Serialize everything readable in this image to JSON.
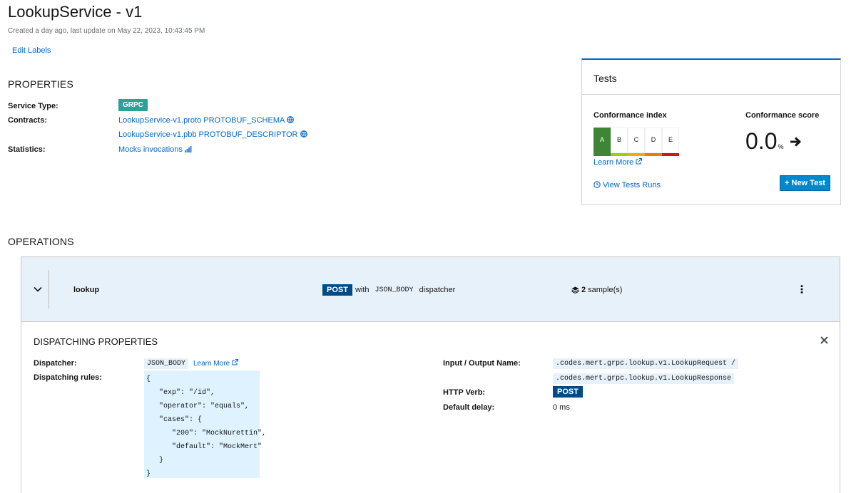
{
  "header": {
    "title": "LookupService - v1",
    "subtitle": "Created a day ago, last update on May 22, 2023, 10:43:45 PM",
    "edit_labels": "Edit Labels"
  },
  "properties": {
    "heading": "PROPERTIES",
    "service_type_label": "Service Type:",
    "service_type": "GRPC",
    "contracts_label": "Contracts:",
    "contracts": [
      "LookupService-v1.proto PROTOBUF_SCHEMA",
      "LookupService-v1.pbb PROTOBUF_DESCRIPTOR"
    ],
    "statistics_label": "Statistics:",
    "statistics_link": "Mocks invocations"
  },
  "tests": {
    "title": "Tests",
    "conformance_index_label": "Conformance index",
    "grades": [
      "A",
      "B",
      "C",
      "D",
      "E"
    ],
    "active_grade": "A",
    "grade_colors": [
      "#3e8635",
      "#92d400",
      "#f0ab00",
      "#ec7a08",
      "#c9190b"
    ],
    "learn_more": "Learn More",
    "view_runs": "View Tests Runs",
    "conformance_score_label": "Conformance score",
    "score": "0.0",
    "score_unit": "%",
    "new_test": "New Test"
  },
  "operations": {
    "heading": "OPERATIONS",
    "op_name": "lookup",
    "verb": "POST",
    "with": "with",
    "dispatcher_chip": "JSON_BODY",
    "dispatcher_word": "dispatcher",
    "samples_count": "2",
    "samples_suffix": "sample(s)"
  },
  "dispatching": {
    "heading": "DISPATCHING PROPERTIES",
    "dispatcher_label": "Dispatcher:",
    "dispatcher": "JSON_BODY",
    "learn_more": "Learn More",
    "rules_label": "Dispatching rules:",
    "rules": "{\n   \"exp\": \"/id\",\n   \"operator\": \"equals\",\n   \"cases\": {\n      \"200\": \"MockNurettin\",\n      \"default\": \"MockMert\"\n   }\n}",
    "io_label": "Input / Output Name:",
    "input_name": ".codes.mert.grpc.lookup.v1.LookupRequest /",
    "output_name": ".codes.mert.grpc.lookup.v1.LookupResponse",
    "http_verb_label": "HTTP Verb:",
    "http_verb": "POST",
    "default_delay_label": "Default delay:",
    "default_delay": "0 ms"
  }
}
